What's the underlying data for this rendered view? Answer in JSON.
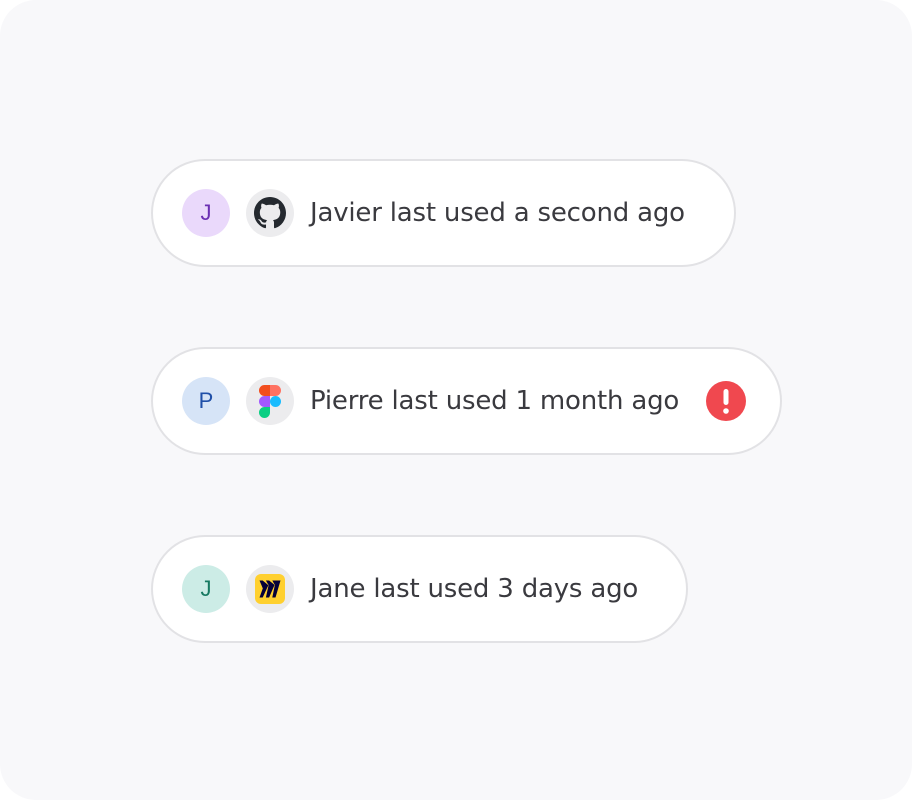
{
  "entries": [
    {
      "avatar_initial": "J",
      "avatar_bg": "#ead9fb",
      "avatar_fg": "#6b2fb3",
      "app_icon": "github-icon",
      "text": "Javier last used a second ago",
      "alert": false
    },
    {
      "avatar_initial": "P",
      "avatar_bg": "#d6e4f7",
      "avatar_fg": "#1f4fa8",
      "app_icon": "figma-icon",
      "text": "Pierre last used 1 month ago",
      "alert": true,
      "alert_icon": "exclamation-icon",
      "alert_color": "#f0484f"
    },
    {
      "avatar_initial": "J",
      "avatar_bg": "#ccece6",
      "avatar_fg": "#177a62",
      "app_icon": "miro-icon",
      "text": "Jane last used 3 days ago",
      "alert": false
    }
  ]
}
